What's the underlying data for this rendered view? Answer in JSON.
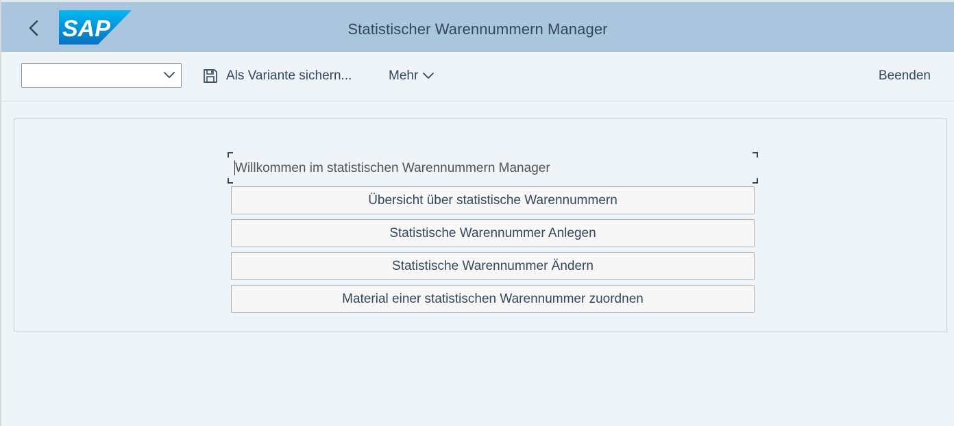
{
  "shell": {
    "title": "Statistischer Warennummern Manager",
    "back_icon": "chevron-left-icon",
    "logo_text": "SAP"
  },
  "toolbar": {
    "variant_value": "",
    "save_variant_label": "Als Variante sichern...",
    "save_icon": "floppy-disk-icon",
    "more_label": "Mehr",
    "exit_label": "Beenden"
  },
  "content": {
    "welcome_text": "Willkommen im statistischen Warennummern Manager",
    "buttons": [
      {
        "label": "Übersicht über statistische Warennummern"
      },
      {
        "label": "Statistische Warennummer Anlegen"
      },
      {
        "label": "Statistische Warennummer Ändern"
      },
      {
        "label": "Material einer statistischen Warennummer zuordnen"
      }
    ]
  },
  "colors": {
    "shell_bg": "#a9c6de",
    "page_bg": "#eff4f9",
    "text_primary": "#32475e",
    "logo_blue": "#0a8ad6"
  }
}
